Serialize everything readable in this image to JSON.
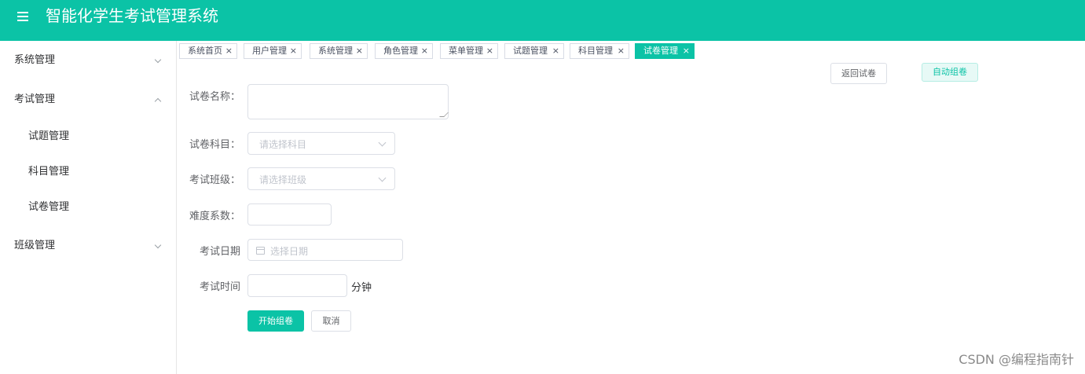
{
  "header": {
    "title": "智能化学生考试管理系统",
    "menu_icon": "menu-icon",
    "bg_color": "#0bc3a6"
  },
  "sidebar": {
    "items": [
      {
        "label": "系统管理",
        "expanded": false
      },
      {
        "label": "考试管理",
        "expanded": true,
        "children": [
          {
            "label": "试题管理"
          },
          {
            "label": "科目管理"
          },
          {
            "label": "试卷管理"
          }
        ]
      },
      {
        "label": "班级管理",
        "expanded": false
      }
    ]
  },
  "tabs": [
    {
      "label": "系统首页",
      "active": false
    },
    {
      "label": "用户管理",
      "active": false
    },
    {
      "label": "系统管理",
      "active": false
    },
    {
      "label": "角色管理",
      "active": false
    },
    {
      "label": "菜单管理",
      "active": false
    },
    {
      "label": "试题管理",
      "active": false
    },
    {
      "label": "科目管理",
      "active": false
    },
    {
      "label": "试卷管理",
      "active": true
    }
  ],
  "tab_close_glyph": "×",
  "actions": {
    "back_label": "返回试卷",
    "auto_label": "自动组卷"
  },
  "form": {
    "name_label": "试卷名称：",
    "name_value": "",
    "subject_label": "试卷科目：",
    "subject_placeholder": "请选择科目",
    "class_label": "考试班级：",
    "class_placeholder": "请选择班级",
    "difficulty_label": "难度系数：",
    "difficulty_value": "",
    "date_label": "考试日期",
    "date_placeholder": "选择日期",
    "time_label": "考试时间",
    "time_value": "",
    "time_unit": "分钟",
    "submit_label": "开始组卷",
    "cancel_label": "取消"
  },
  "watermark": "CSDN @编程指南针"
}
